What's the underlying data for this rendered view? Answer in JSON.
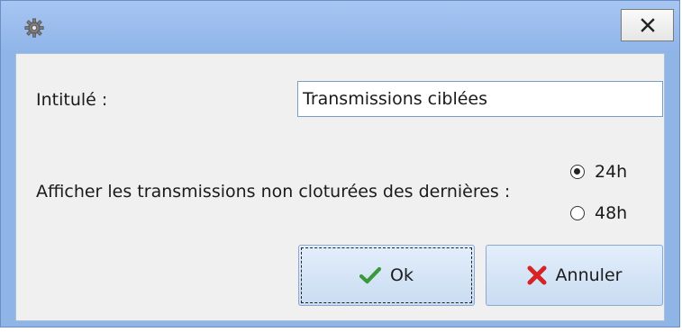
{
  "window": {
    "icon": "gear-icon",
    "close_icon": "close-icon"
  },
  "form": {
    "intitule_label": "Intitulé :",
    "intitule_value": "Transmissions ciblées",
    "display_label": "Afficher les transmissions non cloturées des dernières :",
    "period_options": [
      {
        "label": "24h",
        "checked": true
      },
      {
        "label": "48h",
        "checked": false
      }
    ]
  },
  "buttons": {
    "ok_label": "Ok",
    "ok_icon": "checkmark-icon",
    "cancel_label": "Annuler",
    "cancel_icon": "cross-icon"
  },
  "colors": {
    "titlebar": "#8fb4e6",
    "ok_check": "#3a9a3a",
    "cancel_cross": "#d62424"
  }
}
